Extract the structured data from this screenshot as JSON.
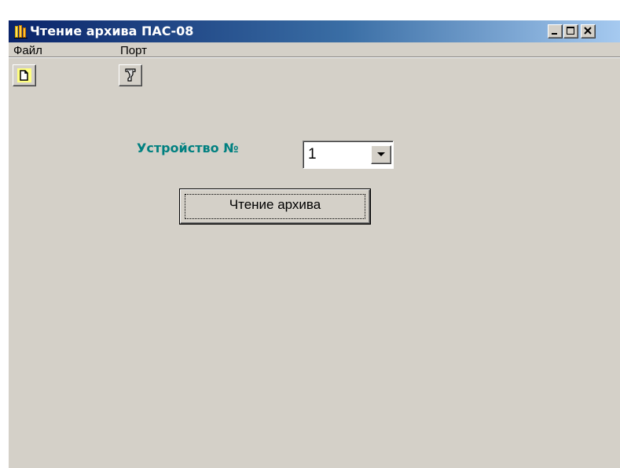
{
  "window": {
    "title": "Чтение архива ПАС-08",
    "title_icon": "app-books-icon"
  },
  "title_buttons": {
    "minimize": "minimize-icon",
    "maximize": "maximize-icon",
    "close": "close-icon"
  },
  "menu": {
    "items": [
      {
        "label": "Файл"
      },
      {
        "label": "Порт"
      }
    ]
  },
  "toolbar": {
    "buttons": [
      {
        "icon": "new-file-icon"
      },
      {
        "icon": "port-icon"
      }
    ]
  },
  "form": {
    "device_label": "Устройство №",
    "device_value": "1",
    "read_button_label": "Чтение архива"
  },
  "colors": {
    "titlebar_start": "#0a246a",
    "titlebar_end": "#a6caf0",
    "window_bg": "#d4d0c8",
    "label_accent": "#008080"
  }
}
